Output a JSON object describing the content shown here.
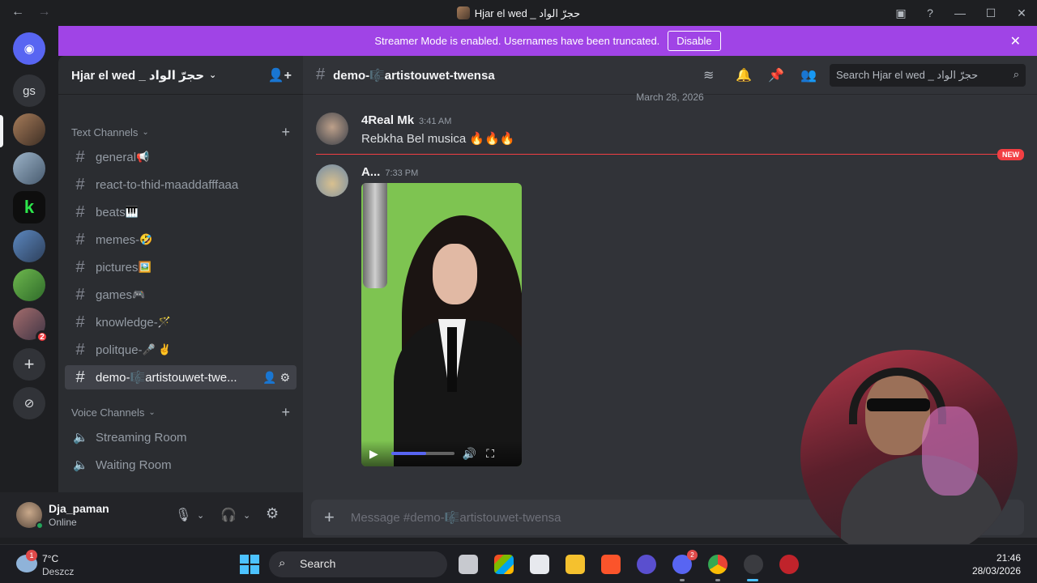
{
  "window": {
    "title": "Hjar el wed _ حجرّ الواد"
  },
  "banner": {
    "message": "Streamer Mode is enabled. Usernames have been truncated.",
    "disable_label": "Disable"
  },
  "rail": {
    "abbrev_server": "gs",
    "voice_badge": "2"
  },
  "server": {
    "name": "Hjar el wed _ حجرّ الواد"
  },
  "sidebar": {
    "text_category": "Text Channels",
    "voice_category": "Voice Channels",
    "text_channels": [
      {
        "name": "general",
        "emoji": "📢"
      },
      {
        "name": "react-to-thid-maaddafffaaa",
        "emoji": ""
      },
      {
        "name": "beats",
        "emoji": "🎹"
      },
      {
        "name": "memes-",
        "emoji": "🤣"
      },
      {
        "name": "pictures",
        "emoji": "🖼️"
      },
      {
        "name": "games",
        "emoji": "🎮"
      },
      {
        "name": "knowledge-",
        "emoji": "🪄"
      },
      {
        "name": "politque-",
        "emoji": "🎤 ✌️"
      },
      {
        "name": "demo-🎼artistouwet-twe...",
        "emoji": ""
      }
    ],
    "voice_channels": [
      {
        "name": "Streaming Room"
      },
      {
        "name": "Waiting Room"
      }
    ]
  },
  "user": {
    "name": "Dja_paman",
    "status": "Online"
  },
  "channel": {
    "name": "demo-🎼artistouwet-twensa",
    "search_placeholder": "Search Hjar el wed _ حجرّ الواد",
    "date_divider": "March 28, 2026",
    "new_label": "NEW",
    "composer_placeholder": "Message #demo-🎼artistouwet-twensa"
  },
  "messages": [
    {
      "author": "4Real Mk",
      "time": "3:41 AM",
      "text": "Rebkha Bel musica 🔥🔥🔥"
    },
    {
      "author": "A...",
      "time": "7:33 PM",
      "text": ""
    }
  ],
  "video": {
    "progress": 0.55
  },
  "taskbar": {
    "weather_badge": "1",
    "temperature": "7°C",
    "condition": "Deszcz",
    "search_label": "Search",
    "discord_badge": "2",
    "time": "21:46",
    "date": "28/03/2026"
  },
  "colors": {
    "banner": "#a044e6",
    "accent": "#5865f2",
    "new_divider": "#f23f43",
    "online": "#23a55a"
  }
}
